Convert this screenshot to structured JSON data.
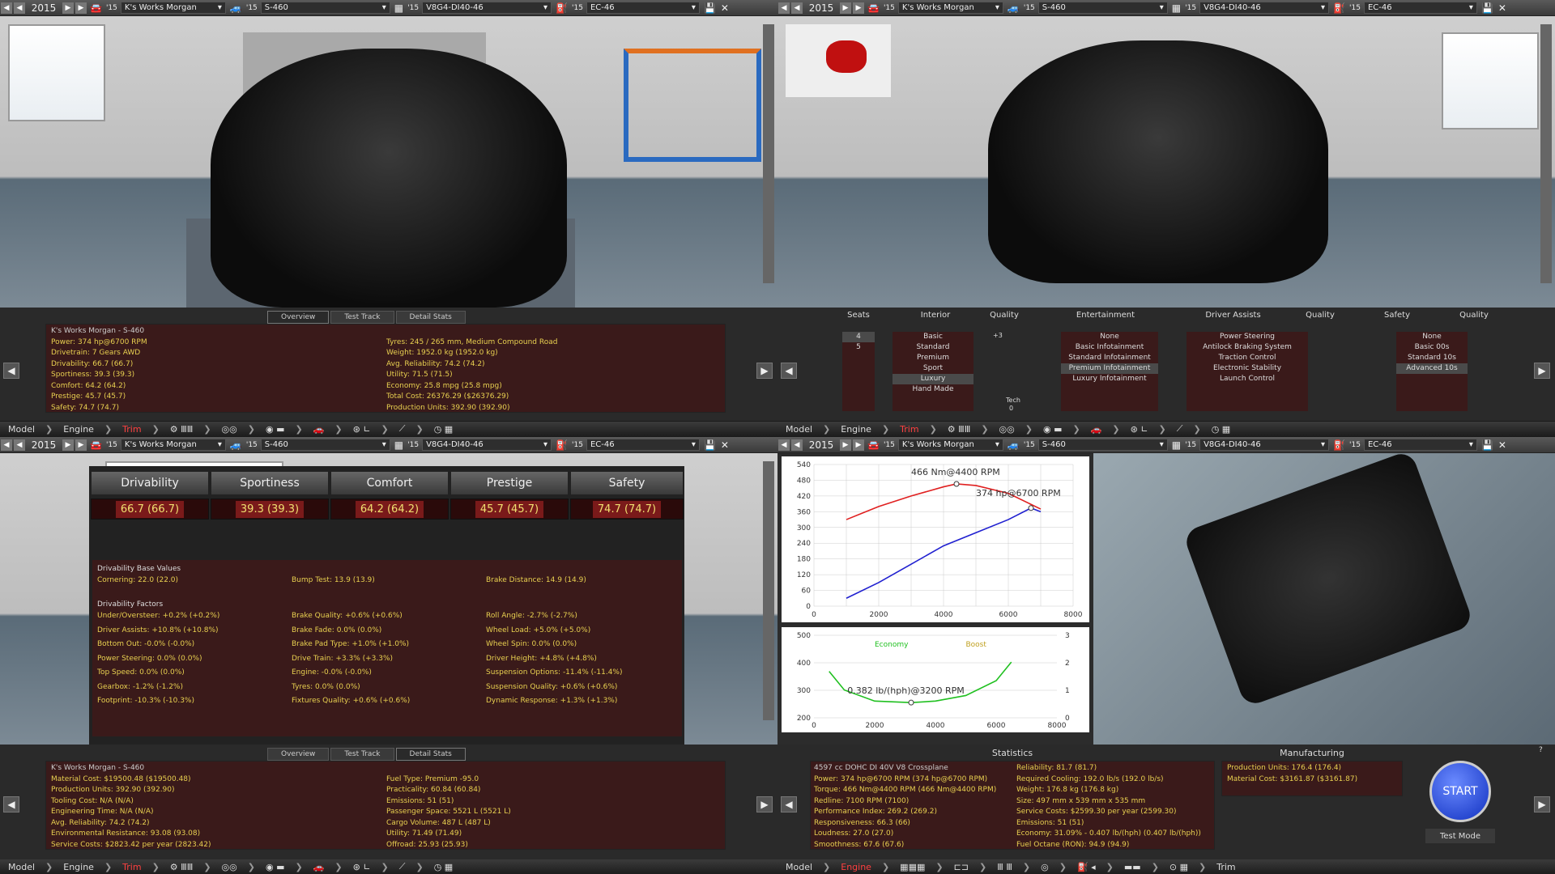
{
  "selector": {
    "year": "2015",
    "model": "K's Works Morgan",
    "model_year": "'15",
    "trim": "S-460",
    "engine": "V8G4-DI40-46",
    "engine_year": "'15",
    "family": "EC-46",
    "family_year": "'15"
  },
  "nav_trim": [
    "Model",
    "Engine",
    "Trim"
  ],
  "nav_engine": [
    "Model",
    "Engine",
    "Trim"
  ],
  "info_tabs": [
    "Overview",
    "Test Track",
    "Detail Stats"
  ],
  "overview": {
    "left": [
      "K's Works Morgan - S-460",
      "Power: 374 hp@6700 RPM",
      "Drivetrain: 7 Gears AWD",
      "Drivability: 66.7 (66.7)",
      "Sportiness: 39.3 (39.3)",
      "Comfort: 64.2 (64.2)",
      "Prestige: 45.7 (45.7)",
      "Safety: 74.7 (74.7)"
    ],
    "right": [
      "",
      "Tyres: 245 / 265 mm, Medium Compound Road",
      "Weight: 1952.0 kg (1952.0 kg)",
      "Avg. Reliability: 74.2 (74.2)",
      "Utility: 71.5 (71.5)",
      "Economy: 25.8 mpg (25.8 mpg)",
      "Total Cost: 26376.29 ($26376.29)",
      "Production Units: 392.90 (392.90)"
    ]
  },
  "interior": {
    "titles": [
      "Seats",
      "Interior",
      "Quality",
      "Entertainment",
      "Driver Assists",
      "Quality",
      "Safety",
      "Quality"
    ],
    "seats": [
      "4",
      "5"
    ],
    "interior": [
      "Basic",
      "Standard",
      "Premium",
      "Sport",
      "Luxury",
      "Hand Made"
    ],
    "entertainment": [
      "None",
      "Basic Infotainment",
      "Standard Infotainment",
      "Premium Infotainment",
      "Luxury Infotainment"
    ],
    "assists": [
      "Power Steering",
      "Antilock Braking System",
      "Traction Control",
      "Electronic Stability",
      "Launch Control"
    ],
    "safety": [
      "None",
      "Basic 00s",
      "Standard 10s",
      "Advanced 10s"
    ],
    "quality_val": "+3",
    "tech_label": "Tech",
    "tech_val": "0"
  },
  "stats_tabs": [
    "Drivability",
    "Sportiness",
    "Comfort",
    "Prestige",
    "Safety"
  ],
  "stats_vals": [
    "66.7 (66.7)",
    "39.3 (39.3)",
    "64.2 (64.2)",
    "45.7 (45.7)",
    "74.7 (74.7)"
  ],
  "drv": {
    "base_title": "Drivability Base Values",
    "base": [
      "Cornering: 22.0 (22.0)",
      "Bump Test: 13.9 (13.9)",
      "Brake Distance: 14.9 (14.9)"
    ],
    "factors_title": "Drivability Factors",
    "factors": [
      "Under/Oversteer: +0.2% (+0.2%)",
      "Brake Quality: +0.6% (+0.6%)",
      "Roll Angle: -2.7% (-2.7%)",
      "Driver Assists: +10.8% (+10.8%)",
      "Brake Fade: 0.0% (0.0%)",
      "Wheel Load: +5.0% (+5.0%)",
      "Bottom Out: -0.0% (-0.0%)",
      "Brake Pad Type: +1.0% (+1.0%)",
      "Wheel Spin: 0.0% (0.0%)",
      "Power Steering: 0.0% (0.0%)",
      "Drive Train: +3.3% (+3.3%)",
      "Driver Height: +4.8% (+4.8%)",
      "Top Speed: 0.0% (0.0%)",
      "Engine: -0.0% (-0.0%)",
      "Suspension Options: -11.4% (-11.4%)",
      "Gearbox: -1.2% (-1.2%)",
      "Tyres: 0.0% (0.0%)",
      "Suspension Quality: +0.6% (+0.6%)",
      "Footprint: -10.3% (-10.3%)",
      "Fixtures Quality: +0.6% (+0.6%)",
      "Dynamic Response: +1.3% (+1.3%)"
    ]
  },
  "chart_data": [
    {
      "type": "line",
      "series": [
        {
          "name": "Torque",
          "x": [
            1000,
            2000,
            3000,
            4000,
            4400,
            5000,
            6000,
            7000
          ],
          "y": [
            330,
            380,
            420,
            455,
            466,
            460,
            430,
            370
          ]
        },
        {
          "name": "Power",
          "x": [
            1000,
            2000,
            3000,
            4000,
            5000,
            6000,
            6700,
            7000
          ],
          "y": [
            30,
            90,
            160,
            230,
            280,
            330,
            374,
            360
          ]
        }
      ],
      "annotations": [
        "466 Nm@4400 RPM",
        "374 hp@6700 RPM"
      ],
      "xticks": [
        "0",
        "2000",
        "4000",
        "6000",
        "8000"
      ],
      "yticks": [
        "540",
        "480",
        "420",
        "360",
        "300",
        "240",
        "180",
        "120",
        "60",
        "0"
      ],
      "xlim": [
        0,
        8000
      ],
      "ylim": [
        0,
        540
      ]
    },
    {
      "type": "line",
      "series": [
        {
          "name": "Economy",
          "x": [
            500,
            1000,
            2000,
            3200,
            4000,
            5000,
            6000,
            6500
          ],
          "y": [
            0.55,
            0.45,
            0.39,
            0.382,
            0.39,
            0.42,
            0.5,
            0.6
          ]
        }
      ],
      "legend": [
        "Economy",
        "Boost"
      ],
      "annotations": [
        "0.382 lb/(hph)@3200 RPM"
      ],
      "xticks": [
        "0",
        "2000",
        "4000",
        "6000",
        "8000"
      ],
      "yticks_left": [
        "500",
        "400",
        "300",
        "200"
      ],
      "yticks_right": [
        "3",
        "2",
        "1",
        "0"
      ],
      "xlim": [
        0,
        8000
      ]
    }
  ],
  "manu_overview": {
    "left": [
      "K's Works Morgan - S-460",
      "Material Cost: $19500.48 ($19500.48)",
      "Production Units: 392.90 (392.90)",
      "Tooling Cost: N/A (N/A)",
      "Engineering Time: N/A (N/A)",
      "Avg. Reliability: 74.2 (74.2)",
      "Environmental Resistance: 93.08 (93.08)",
      "Service Costs: $2823.42 per year (2823.42)"
    ],
    "right": [
      "",
      "Fuel Type: Premium -95.0",
      "Practicality: 60.84 (60.84)",
      "Emissions: 51 (51)",
      "Passenger Space: 5521 L (5521 L)",
      "Cargo Volume: 487 L (487 L)",
      "Utility: 71.49 (71.49)",
      "Offroad: 25.93 (25.93)"
    ]
  },
  "engine_stats": {
    "title": "Statistics",
    "left": [
      "4597 cc DOHC DI 40V V8 Crossplane",
      "Power: 374 hp@6700 RPM (374 hp@6700 RPM)",
      "Torque: 466 Nm@4400 RPM (466 Nm@4400 RPM)",
      "Redline: 7100 RPM (7100)",
      "Performance Index: 269.2 (269.2)",
      "Responsiveness: 66.3 (66)",
      "Loudness: 27.0 (27.0)",
      "Smoothness: 67.6 (67.6)"
    ],
    "right": [
      "Reliability: 81.7 (81.7)",
      "Required Cooling: 192.0 lb/s (192.0 lb/s)",
      "Weight: 176.8 kg (176.8 kg)",
      "Size: 497 mm x 539 mm x 535 mm",
      "Service Costs: $2599.30 per year (2599.30)",
      "Emissions: 51 (51)",
      "Economy: 31.09% - 0.407 lb/(hph) (0.407 lb/(hph))",
      "Fuel Octane (RON): 94.9 (94.9)"
    ]
  },
  "manufacturing": {
    "title": "Manufacturing",
    "lines": [
      "Production Units: 176.4 (176.4)",
      "Material Cost: $3161.87 ($3161.87)"
    ],
    "start": "START",
    "test_mode": "Test Mode",
    "help": "?"
  }
}
